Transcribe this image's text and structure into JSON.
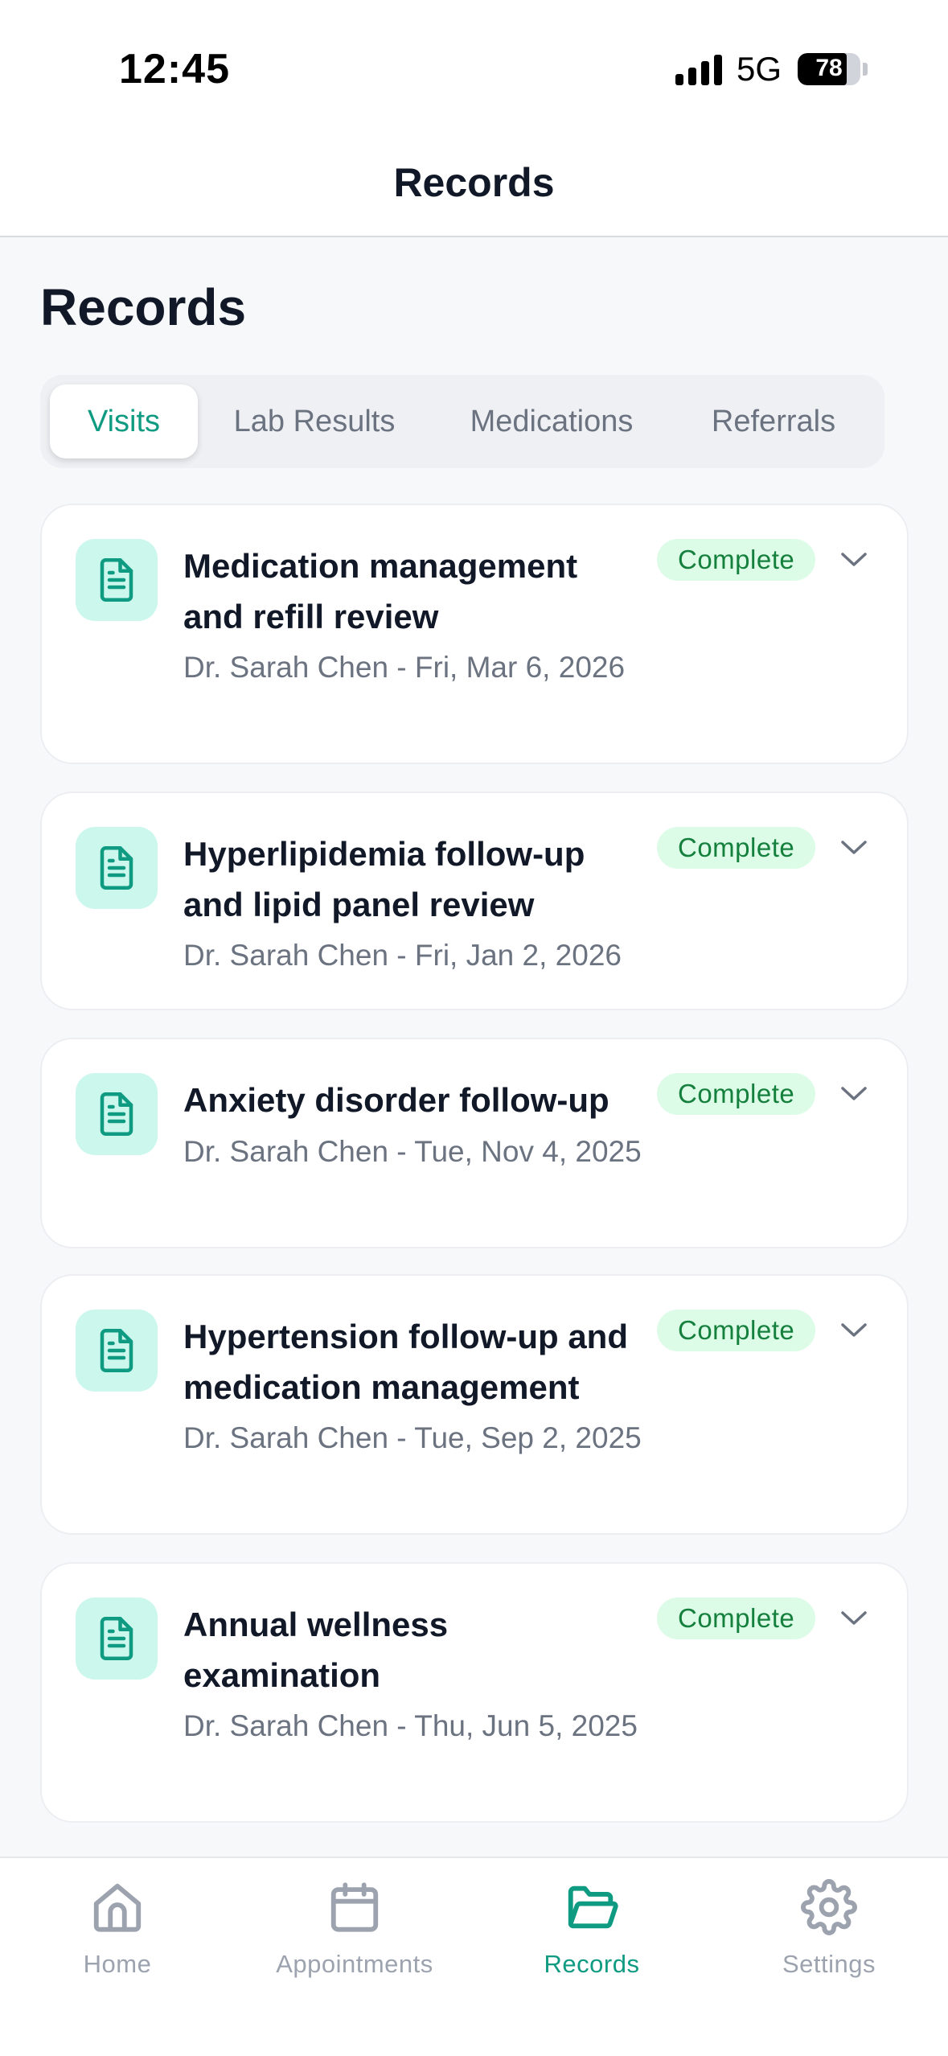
{
  "status_bar": {
    "time": "12:45",
    "network": "5G",
    "battery_percent": "78",
    "battery_level": 0.78
  },
  "nav": {
    "title": "Records"
  },
  "page": {
    "heading": "Records"
  },
  "tabs": [
    {
      "label": "Visits",
      "active": true
    },
    {
      "label": "Lab Results",
      "active": false
    },
    {
      "label": "Medications",
      "active": false
    },
    {
      "label": "Referrals",
      "active": false
    }
  ],
  "records": [
    {
      "title": "Medication management and refill review",
      "subtitle": "Dr. Sarah Chen - Fri, Mar 6, 2026",
      "status": "Complete",
      "icon": "document-icon"
    },
    {
      "title": "Hyperlipidemia follow-up and lipid panel review",
      "subtitle": "Dr. Sarah Chen - Fri, Jan 2, 2026",
      "status": "Complete",
      "icon": "document-icon"
    },
    {
      "title": "Anxiety disorder follow-up",
      "subtitle": "Dr. Sarah Chen - Tue, Nov 4, 2025",
      "status": "Complete",
      "icon": "document-icon"
    },
    {
      "title": "Hypertension follow-up and medication management",
      "subtitle": "Dr. Sarah Chen - Tue, Sep 2, 2025",
      "status": "Complete",
      "icon": "document-icon"
    },
    {
      "title": "Annual wellness examination",
      "subtitle": "Dr. Sarah Chen - Thu, Jun 5, 2025",
      "status": "Complete",
      "icon": "document-icon"
    }
  ],
  "tab_bar": [
    {
      "label": "Home",
      "icon": "home-icon",
      "active": false
    },
    {
      "label": "Appointments",
      "icon": "calendar-icon",
      "active": false
    },
    {
      "label": "Records",
      "icon": "folder-icon",
      "active": true
    },
    {
      "label": "Settings",
      "icon": "gear-icon",
      "active": false
    }
  ],
  "colors": {
    "accent": "#0f9a82",
    "badge_bg": "#dcfce7",
    "badge_text": "#15803d",
    "icon_bg": "#ccf7ec",
    "muted": "#6b7280"
  }
}
